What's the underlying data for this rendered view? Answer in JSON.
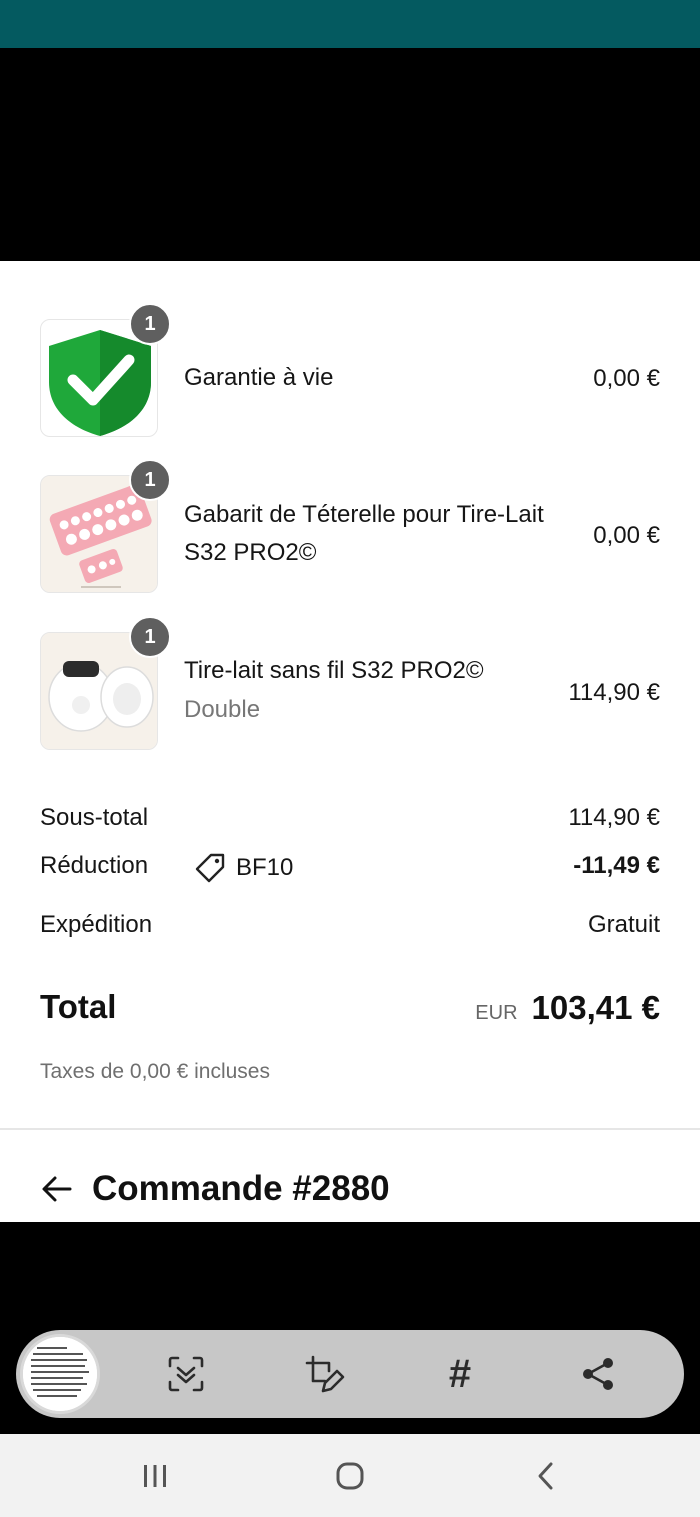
{
  "items": [
    {
      "qty": "1",
      "name": "Garantie à vie",
      "variant": "",
      "price": "0,00 €",
      "image": "shield-check-icon"
    },
    {
      "qty": "1",
      "name": "Gabarit de Téterelle pour Tire-Lait S32 PRO2©",
      "variant": "",
      "price": "0,00 €",
      "image": "flange-sizing-ruler"
    },
    {
      "qty": "1",
      "name": "Tire-lait sans fil S32 PRO2©",
      "variant": "Double",
      "price": "114,90 €",
      "image": "breast-pump-pair"
    }
  ],
  "summary": {
    "subtotal_label": "Sous-total",
    "subtotal_value": "114,90 €",
    "discount_label": "Réduction",
    "discount_code": "BF10",
    "discount_value": "-11,49 €",
    "shipping_label": "Expédition",
    "shipping_value": "Gratuit",
    "total_label": "Total",
    "total_currency": "EUR",
    "total_value": "103,41 €",
    "taxes_note": "Taxes de 0,00 € incluses"
  },
  "order": {
    "title": "Commande #2880"
  },
  "toolbar": {
    "icons": [
      "thumbnail-preview",
      "scan-text-icon",
      "edit-crop-icon",
      "hashtag-icon",
      "share-icon"
    ],
    "hashtag_glyph": "#"
  },
  "colors": {
    "status_bar": "#045a60",
    "shield_green": "#1fa83a",
    "badge": "#5f5f5f"
  }
}
